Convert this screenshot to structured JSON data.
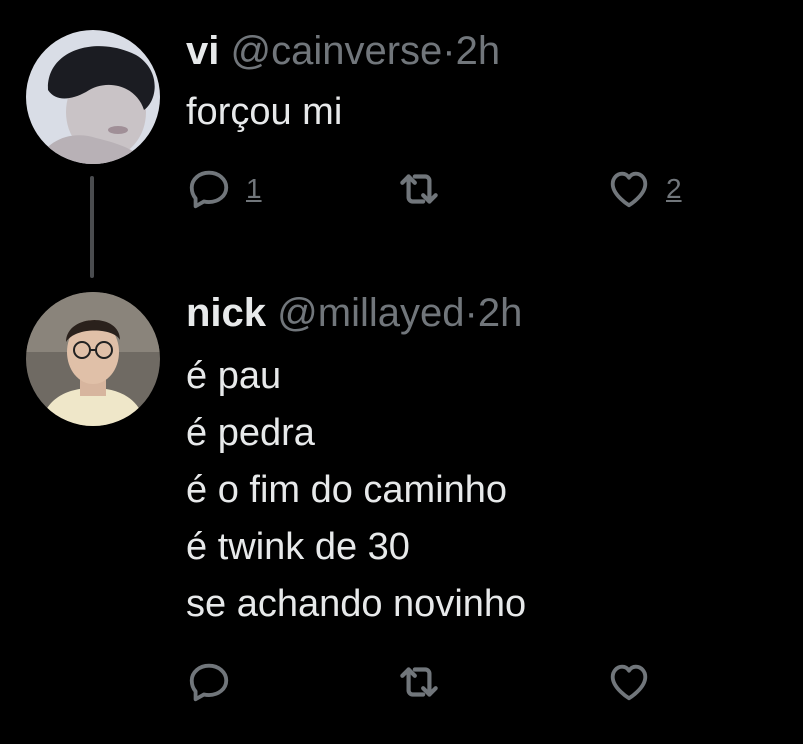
{
  "colors": {
    "background": "#000000",
    "text_primary": "#e7e9ea",
    "text_secondary": "#71767b",
    "thread_line": "#4a4c4f"
  },
  "tweets": [
    {
      "name": "vi",
      "handle": "@cainverse",
      "separator": "·",
      "time": "2h",
      "lines": [
        "forçou mi"
      ],
      "reply_count": "1",
      "like_count": "2",
      "icons": [
        "reply-icon",
        "retweet-icon",
        "like-icon"
      ]
    },
    {
      "name": "nick",
      "handle": "@millayed",
      "separator": "·",
      "time": "2h",
      "lines": [
        "é pau",
        "é pedra",
        "é o fim do caminho",
        "é twink de 30",
        "se achando novinho"
      ],
      "icons": [
        "reply-icon",
        "retweet-icon",
        "like-icon"
      ]
    }
  ]
}
